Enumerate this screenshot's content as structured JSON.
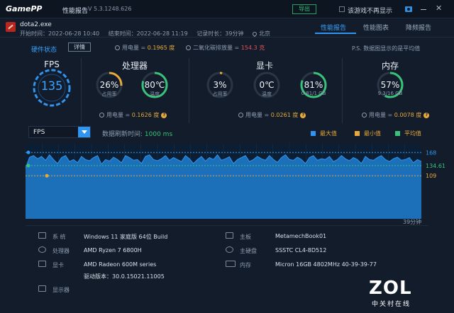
{
  "window": {
    "logo": "GamePP",
    "title": "性能报告",
    "version": "V 5.3.1248.626",
    "export_label": "导出",
    "hide_from_game_label": "该游戏不再显示"
  },
  "session": {
    "app_name": "dota2.exe",
    "start_time": "开始时间：2022-06-28 10:40",
    "end_time": "结束时间：2022-06-28 11:19",
    "duration": "记录时长：39分钟",
    "location": "北京"
  },
  "tabs": [
    {
      "label": "性能报告",
      "active": true
    },
    {
      "label": "性能图表",
      "active": false
    },
    {
      "label": "降频报告",
      "active": false
    }
  ],
  "hardware": {
    "label": "硬件状态",
    "detail_label": "详情",
    "power_label": "用电量 = ",
    "power_value": "0.1965 度",
    "co2_label": "二氧化碳排放量 = ",
    "co2_value": "154.3 克",
    "note": "P.S. 数据图显示的是平均值"
  },
  "cards": {
    "fps": {
      "title": "FPS",
      "value": "135"
    },
    "cpu": {
      "title": "处理器",
      "usage": {
        "value": "26%",
        "label": "占用率",
        "fraction": 0.26,
        "color": "#e7a93a"
      },
      "temp": {
        "value": "80℃",
        "label": "温度",
        "fraction": 0.8,
        "color": "#3ac27b"
      },
      "power_label": "用电量 = ",
      "power_value": "0.1626 度"
    },
    "gpu": {
      "title": "显卡",
      "usage": {
        "value": "3%",
        "label": "占用率",
        "fraction": 0.03,
        "color": "#e7a93a"
      },
      "temp": {
        "value": "0℃",
        "label": "温度",
        "fraction": 0.0,
        "color": "#3ac27b"
      },
      "vram": {
        "value": "81%",
        "label": "0.81/1 GB",
        "fraction": 0.81,
        "color": "#3ac27b"
      },
      "power_label": "用电量 = ",
      "power_value": "0.0261 度"
    },
    "mem": {
      "title": "内存",
      "usage": {
        "value": "57%",
        "label": "9.3/16 GB",
        "fraction": 0.57,
        "color": "#3ac27b"
      },
      "power_label": "用电量 = ",
      "power_value": "0.0078 度"
    }
  },
  "chart_toolbar": {
    "metric": "FPS",
    "refresh_label": "数据刷新时间: ",
    "refresh_value": "1000 ms"
  },
  "chart_data": {
    "type": "area",
    "title": "",
    "xlabel": "39分钟",
    "ylabel": "",
    "legend": [
      {
        "name": "最大值",
        "color": "#2f95f0"
      },
      {
        "name": "最小值",
        "color": "#e7a93a"
      },
      {
        "name": "平均值",
        "color": "#3ac27b"
      }
    ],
    "legend_position": "top-right",
    "reference_lines": {
      "max": 168,
      "avg": 134.61,
      "min": 109
    },
    "labels": {
      "max": "168",
      "avg": "134.61",
      "min": "109"
    },
    "ylim": [
      0,
      190
    ],
    "series": [
      {
        "values": [
          128,
          156,
          160,
          152,
          158,
          148,
          162,
          150,
          140,
          155,
          160,
          145,
          150,
          142,
          158,
          150,
          147,
          155,
          160,
          138,
          150,
          146,
          156,
          150,
          142,
          160,
          155,
          148,
          150,
          140,
          158,
          162,
          150,
          147,
          152,
          160,
          148,
          155,
          150,
          145,
          160,
          152,
          140,
          150,
          158,
          146,
          155,
          150,
          162,
          148,
          152,
          157,
          140,
          150,
          155,
          160,
          145,
          150,
          158,
          152,
          148,
          160,
          150,
          143,
          155,
          162,
          150,
          148,
          156,
          150,
          140,
          155,
          160,
          148,
          152,
          150,
          158,
          145,
          150,
          160,
          152,
          147,
          155,
          150,
          140,
          158,
          150,
          148,
          155,
          160,
          150,
          145,
          152,
          156,
          148,
          150,
          155,
          142,
          150,
          145
        ]
      }
    ]
  },
  "system_info": {
    "left": [
      {
        "key": "系  统",
        "value": "Windows 11 家庭版 64位   Build"
      },
      {
        "key": "处理器",
        "value": "AMD Ryzen 7 6800H"
      },
      {
        "key": "显卡",
        "value": "AMD Radeon 600M series"
      },
      {
        "key": "",
        "value": "驱动版本：30.0.15021.11005"
      },
      {
        "key": "显示器",
        "value": ""
      }
    ],
    "right": [
      {
        "key": "主板",
        "value": "MetamechBook01"
      },
      {
        "key": "主硬盘",
        "value": "SSSTC CL4-8D512"
      },
      {
        "key": "内存",
        "value": "Micron 16GB 4802MHz 40-39-39-77"
      }
    ]
  },
  "watermark": {
    "brand": "ZOL",
    "sub": "中关村在线"
  }
}
